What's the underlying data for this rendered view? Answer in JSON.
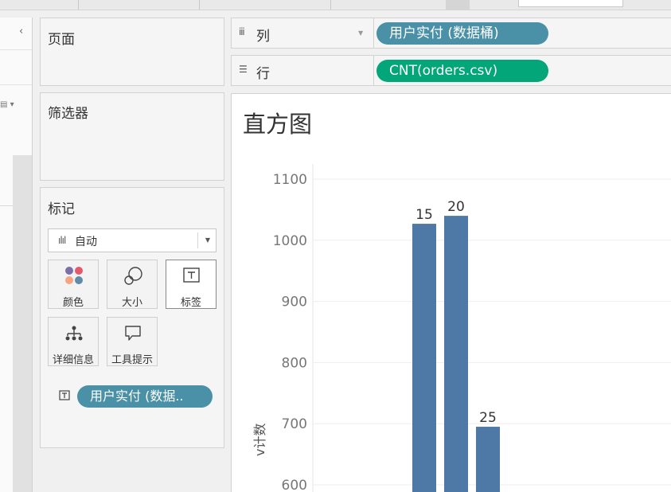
{
  "shelves": {
    "pages_title": "页面",
    "filters_title": "筛选器",
    "marks_title": "标记",
    "columns_label": "列",
    "rows_label": "行",
    "columns_pill": "用户实付 (数据桶)",
    "rows_pill": "CNT(orders.csv)"
  },
  "marks": {
    "type_selected": "自动",
    "buttons": [
      {
        "label": "颜色",
        "icon": "color-dots-icon"
      },
      {
        "label": "大小",
        "icon": "size-circles-icon"
      },
      {
        "label": "标签",
        "icon": "label-t-icon"
      },
      {
        "label": "详细信息",
        "icon": "detail-tree-icon"
      },
      {
        "label": "工具提示",
        "icon": "tooltip-bubble-icon"
      }
    ],
    "label_pill": "用户实付 (数据.."
  },
  "view": {
    "title": "直方图",
    "ytitle": "v计数"
  },
  "colors": {
    "bar": "#4e79a7",
    "pill_blue": "#4a90a7",
    "pill_green": "#03a678",
    "color_dots": [
      "#7b6fa8",
      "#e55a6a",
      "#f4a582",
      "#5f8ca7"
    ]
  },
  "chart_data": {
    "type": "bar",
    "y_ticks": [
      600,
      700,
      800,
      900,
      1000,
      1100
    ],
    "ylim": [
      550,
      1100
    ],
    "grid": true,
    "bars": [
      {
        "label": "15",
        "value": 1027
      },
      {
        "label": "20",
        "value": 1040
      },
      {
        "label": "25",
        "value": 695
      }
    ]
  }
}
